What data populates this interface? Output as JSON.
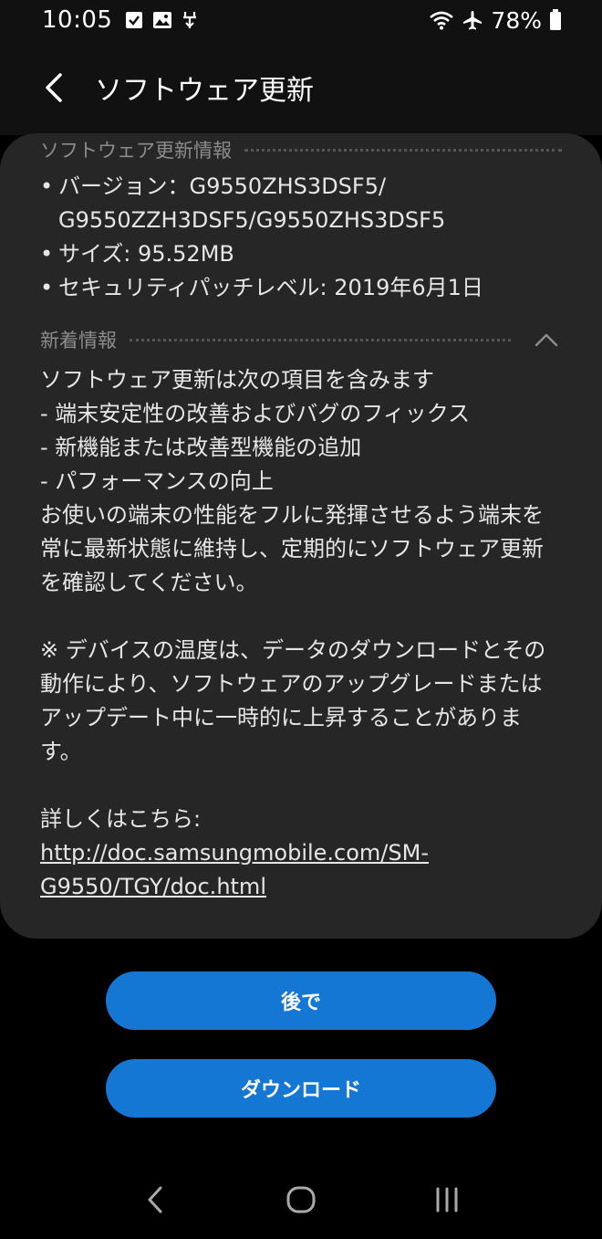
{
  "status_bar": {
    "time": "10:05",
    "battery": "78%",
    "icons": [
      "check-box-icon",
      "image-icon",
      "usb-icon",
      "wifi-icon",
      "airplane-icon",
      "battery-icon"
    ]
  },
  "app_bar": {
    "title": "ソフトウェア更新"
  },
  "info_section": {
    "header": "ソフトウェア更新情報",
    "items": [
      "バージョン：G9550ZHS3DSF5/ G9550ZZH3DSF5/G9550ZHS3DSF5",
      "サイズ: 95.52MB",
      "セキュリティパッチレベル: 2019年6月1日"
    ]
  },
  "news_section": {
    "header": "新着情報",
    "lines": [
      "ソフトウェア更新は次の項目を含みます",
      " - 端末安定性の改善およびバグのフィックス",
      " - 新機能または改善型機能の追加",
      " - パフォーマンスの向上",
      "お使いの端末の性能をフルに発揮させるよう端末を常に最新状態に維持し、定期的にソフトウェア更新を確認してください。",
      "",
      "※ デバイスの温度は、データのダウンロードとその動作により、ソフトウェアのアップグレードまたはアップデート中に一時的に上昇することがあります。",
      "",
      "詳しくはこちら:"
    ],
    "link": "http://doc.samsungmobile.com/SM-G9550/TGY/doc.html"
  },
  "buttons": {
    "later": "後で",
    "download": "ダウンロード"
  },
  "colors": {
    "accent": "#1477d4",
    "card": "#262626",
    "background": "#000000"
  }
}
